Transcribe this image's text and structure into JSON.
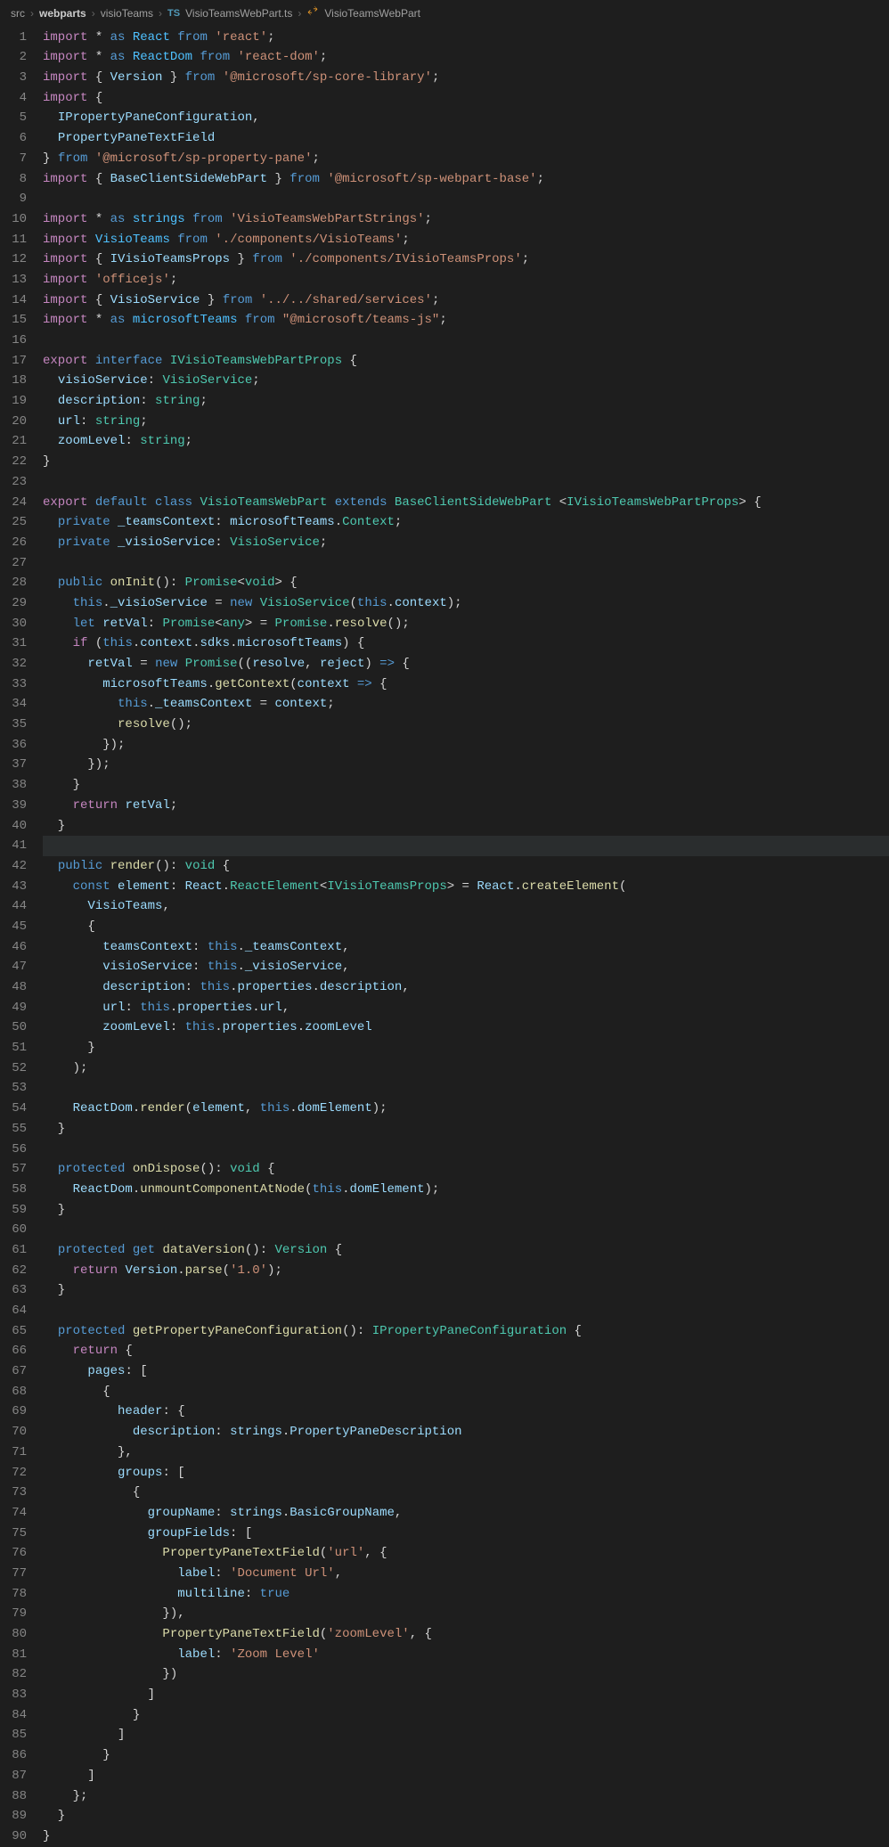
{
  "breadcrumb": {
    "p1": "src",
    "p2": "webparts",
    "p3": "visioTeams",
    "file": "VisioTeamsWebPart.ts",
    "symbol": "VisioTeamsWebPart",
    "tsBadge": "TS"
  },
  "code": {
    "lines": [
      {
        "n": 1,
        "h": "<span class='k'>import</span> <span class='p'>*</span> <span class='kb'>as</span> <span class='i'>React</span> <span class='kb'>from</span> <span class='s'>'react'</span>;"
      },
      {
        "n": 2,
        "h": "<span class='k'>import</span> <span class='p'>*</span> <span class='kb'>as</span> <span class='i'>ReactDom</span> <span class='kb'>from</span> <span class='s'>'react-dom'</span>;"
      },
      {
        "n": 3,
        "h": "<span class='k'>import</span> { <span class='v'>Version</span> } <span class='kb'>from</span> <span class='s'>'@microsoft/sp-core-library'</span>;"
      },
      {
        "n": 4,
        "h": "<span class='k'>import</span> {"
      },
      {
        "n": 5,
        "h": "  <span class='v'>IPropertyPaneConfiguration</span>,"
      },
      {
        "n": 6,
        "h": "  <span class='v'>PropertyPaneTextField</span>"
      },
      {
        "n": 7,
        "h": "} <span class='kb'>from</span> <span class='s'>'@microsoft/sp-property-pane'</span>;"
      },
      {
        "n": 8,
        "h": "<span class='k'>import</span> { <span class='v'>BaseClientSideWebPart</span> } <span class='kb'>from</span> <span class='s'>'@microsoft/sp-webpart-base'</span>;"
      },
      {
        "n": 9,
        "h": ""
      },
      {
        "n": 10,
        "h": "<span class='k'>import</span> <span class='p'>*</span> <span class='kb'>as</span> <span class='i'>strings</span> <span class='kb'>from</span> <span class='s'>'VisioTeamsWebPartStrings'</span>;"
      },
      {
        "n": 11,
        "h": "<span class='k'>import</span> <span class='i'>VisioTeams</span> <span class='kb'>from</span> <span class='s'>'./components/VisioTeams'</span>;"
      },
      {
        "n": 12,
        "h": "<span class='k'>import</span> { <span class='v'>IVisioTeamsProps</span> } <span class='kb'>from</span> <span class='s'>'./components/IVisioTeamsProps'</span>;"
      },
      {
        "n": 13,
        "h": "<span class='k'>import</span> <span class='s'>'officejs'</span>;"
      },
      {
        "n": 14,
        "h": "<span class='k'>import</span> { <span class='v'>VisioService</span> } <span class='kb'>from</span> <span class='s'>'../../shared/services'</span>;"
      },
      {
        "n": 15,
        "h": "<span class='k'>import</span> <span class='p'>*</span> <span class='kb'>as</span> <span class='i'>microsoftTeams</span> <span class='kb'>from</span> <span class='s'>\"@microsoft/teams-js\"</span>;"
      },
      {
        "n": 16,
        "h": ""
      },
      {
        "n": 17,
        "h": "<span class='k'>export</span> <span class='kb'>interface</span> <span class='ty'>IVisioTeamsWebPartProps</span> {"
      },
      {
        "n": 18,
        "h": "  <span class='v'>visioService</span>: <span class='ty'>VisioService</span>;"
      },
      {
        "n": 19,
        "h": "  <span class='v'>description</span>: <span class='ty'>string</span>;"
      },
      {
        "n": 20,
        "h": "  <span class='v'>url</span>: <span class='ty'>string</span>;"
      },
      {
        "n": 21,
        "h": "  <span class='v'>zoomLevel</span>: <span class='ty'>string</span>;"
      },
      {
        "n": 22,
        "h": "}"
      },
      {
        "n": 23,
        "h": ""
      },
      {
        "n": 24,
        "h": "<span class='k'>export</span> <span class='kb'>default</span> <span class='kb'>class</span> <span class='ty'>VisioTeamsWebPart</span> <span class='kb'>extends</span> <span class='ty'>BaseClientSideWebPart</span> &lt;<span class='ty'>IVisioTeamsWebPartProps</span>&gt; {"
      },
      {
        "n": 25,
        "h": "  <span class='kb'>private</span> <span class='v'>_teamsContext</span>: <span class='v'>microsoftTeams</span>.<span class='ty'>Context</span>;"
      },
      {
        "n": 26,
        "h": "  <span class='kb'>private</span> <span class='v'>_visioService</span>: <span class='ty'>VisioService</span>;"
      },
      {
        "n": 27,
        "h": ""
      },
      {
        "n": 28,
        "h": "  <span class='kb'>public</span> <span class='fn'>onInit</span>(): <span class='ty'>Promise</span>&lt;<span class='ty'>void</span>&gt; {"
      },
      {
        "n": 29,
        "h": "    <span class='kb'>this</span>.<span class='v'>_visioService</span> = <span class='kb'>new</span> <span class='ty'>VisioService</span>(<span class='kb'>this</span>.<span class='v'>context</span>);"
      },
      {
        "n": 30,
        "h": "    <span class='kb'>let</span> <span class='v'>retVal</span>: <span class='ty'>Promise</span>&lt;<span class='ty'>any</span>&gt; = <span class='ty'>Promise</span>.<span class='fn'>resolve</span>();"
      },
      {
        "n": 31,
        "h": "    <span class='k'>if</span> (<span class='kb'>this</span>.<span class='v'>context</span>.<span class='v'>sdks</span>.<span class='v'>microsoftTeams</span>) {"
      },
      {
        "n": 32,
        "h": "      <span class='v'>retVal</span> = <span class='kb'>new</span> <span class='ty'>Promise</span>((<span class='v'>resolve</span>, <span class='v'>reject</span>) <span class='kb'>=&gt;</span> {"
      },
      {
        "n": 33,
        "h": "        <span class='v'>microsoftTeams</span>.<span class='fn'>getContext</span>(<span class='v'>context</span> <span class='kb'>=&gt;</span> {"
      },
      {
        "n": 34,
        "h": "          <span class='kb'>this</span>.<span class='v'>_teamsContext</span> = <span class='v'>context</span>;"
      },
      {
        "n": 35,
        "h": "          <span class='fn'>resolve</span>();"
      },
      {
        "n": 36,
        "h": "        });"
      },
      {
        "n": 37,
        "h": "      });"
      },
      {
        "n": 38,
        "h": "    }"
      },
      {
        "n": 39,
        "h": "    <span class='k'>return</span> <span class='v'>retVal</span>;"
      },
      {
        "n": 40,
        "h": "  }"
      },
      {
        "n": 41,
        "hl": true,
        "h": ""
      },
      {
        "n": 42,
        "h": "  <span class='kb'>public</span> <span class='fn'>render</span>(): <span class='ty'>void</span> {"
      },
      {
        "n": 43,
        "h": "    <span class='kb'>const</span> <span class='v'>element</span>: <span class='v'>React</span>.<span class='ty'>ReactElement</span>&lt;<span class='ty'>IVisioTeamsProps</span>&gt; = <span class='v'>React</span>.<span class='fn'>createElement</span>("
      },
      {
        "n": 44,
        "h": "      <span class='v'>VisioTeams</span>,"
      },
      {
        "n": 45,
        "h": "      {"
      },
      {
        "n": 46,
        "h": "        <span class='v'>teamsContext</span>: <span class='kb'>this</span>.<span class='v'>_teamsContext</span>,"
      },
      {
        "n": 47,
        "h": "        <span class='v'>visioService</span>: <span class='kb'>this</span>.<span class='v'>_visioService</span>,"
      },
      {
        "n": 48,
        "h": "        <span class='v'>description</span>: <span class='kb'>this</span>.<span class='v'>properties</span>.<span class='v'>description</span>,"
      },
      {
        "n": 49,
        "h": "        <span class='v'>url</span>: <span class='kb'>this</span>.<span class='v'>properties</span>.<span class='v'>url</span>,"
      },
      {
        "n": 50,
        "h": "        <span class='v'>zoomLevel</span>: <span class='kb'>this</span>.<span class='v'>properties</span>.<span class='v'>zoomLevel</span>"
      },
      {
        "n": 51,
        "h": "      }"
      },
      {
        "n": 52,
        "h": "    );"
      },
      {
        "n": 53,
        "h": ""
      },
      {
        "n": 54,
        "h": "    <span class='v'>ReactDom</span>.<span class='fn'>render</span>(<span class='v'>element</span>, <span class='kb'>this</span>.<span class='v'>domElement</span>);"
      },
      {
        "n": 55,
        "h": "  }"
      },
      {
        "n": 56,
        "h": ""
      },
      {
        "n": 57,
        "h": "  <span class='kb'>protected</span> <span class='fn'>onDispose</span>(): <span class='ty'>void</span> {"
      },
      {
        "n": 58,
        "h": "    <span class='v'>ReactDom</span>.<span class='fn'>unmountComponentAtNode</span>(<span class='kb'>this</span>.<span class='v'>domElement</span>);"
      },
      {
        "n": 59,
        "h": "  }"
      },
      {
        "n": 60,
        "h": ""
      },
      {
        "n": 61,
        "h": "  <span class='kb'>protected</span> <span class='kb'>get</span> <span class='fn'>dataVersion</span>(): <span class='ty'>Version</span> {"
      },
      {
        "n": 62,
        "h": "    <span class='k'>return</span> <span class='v'>Version</span>.<span class='fn'>parse</span>(<span class='s'>'1.0'</span>);"
      },
      {
        "n": 63,
        "h": "  }"
      },
      {
        "n": 64,
        "h": ""
      },
      {
        "n": 65,
        "h": "  <span class='kb'>protected</span> <span class='fn'>getPropertyPaneConfiguration</span>(): <span class='ty'>IPropertyPaneConfiguration</span> {"
      },
      {
        "n": 66,
        "h": "    <span class='k'>return</span> {"
      },
      {
        "n": 67,
        "h": "      <span class='v'>pages</span>: ["
      },
      {
        "n": 68,
        "h": "        {"
      },
      {
        "n": 69,
        "h": "          <span class='v'>header</span>: {"
      },
      {
        "n": 70,
        "h": "            <span class='v'>description</span>: <span class='v'>strings</span>.<span class='v'>PropertyPaneDescription</span>"
      },
      {
        "n": 71,
        "h": "          },"
      },
      {
        "n": 72,
        "h": "          <span class='v'>groups</span>: ["
      },
      {
        "n": 73,
        "h": "            {"
      },
      {
        "n": 74,
        "h": "              <span class='v'>groupName</span>: <span class='v'>strings</span>.<span class='v'>BasicGroupName</span>,"
      },
      {
        "n": 75,
        "h": "              <span class='v'>groupFields</span>: ["
      },
      {
        "n": 76,
        "h": "                <span class='fn'>PropertyPaneTextField</span>(<span class='s'>'url'</span>, {"
      },
      {
        "n": 77,
        "h": "                  <span class='v'>label</span>: <span class='s'>'Document Url'</span>,"
      },
      {
        "n": 78,
        "h": "                  <span class='v'>multiline</span>: <span class='kb'>true</span>"
      },
      {
        "n": 79,
        "h": "                }),"
      },
      {
        "n": 80,
        "h": "                <span class='fn'>PropertyPaneTextField</span>(<span class='s'>'zoomLevel'</span>, {"
      },
      {
        "n": 81,
        "h": "                  <span class='v'>label</span>: <span class='s'>'Zoom Level'</span>"
      },
      {
        "n": 82,
        "h": "                })"
      },
      {
        "n": 83,
        "h": "              ]"
      },
      {
        "n": 84,
        "h": "            }"
      },
      {
        "n": 85,
        "h": "          ]"
      },
      {
        "n": 86,
        "h": "        }"
      },
      {
        "n": 87,
        "h": "      ]"
      },
      {
        "n": 88,
        "h": "    };"
      },
      {
        "n": 89,
        "h": "  }"
      },
      {
        "n": 90,
        "h": "}"
      }
    ]
  }
}
